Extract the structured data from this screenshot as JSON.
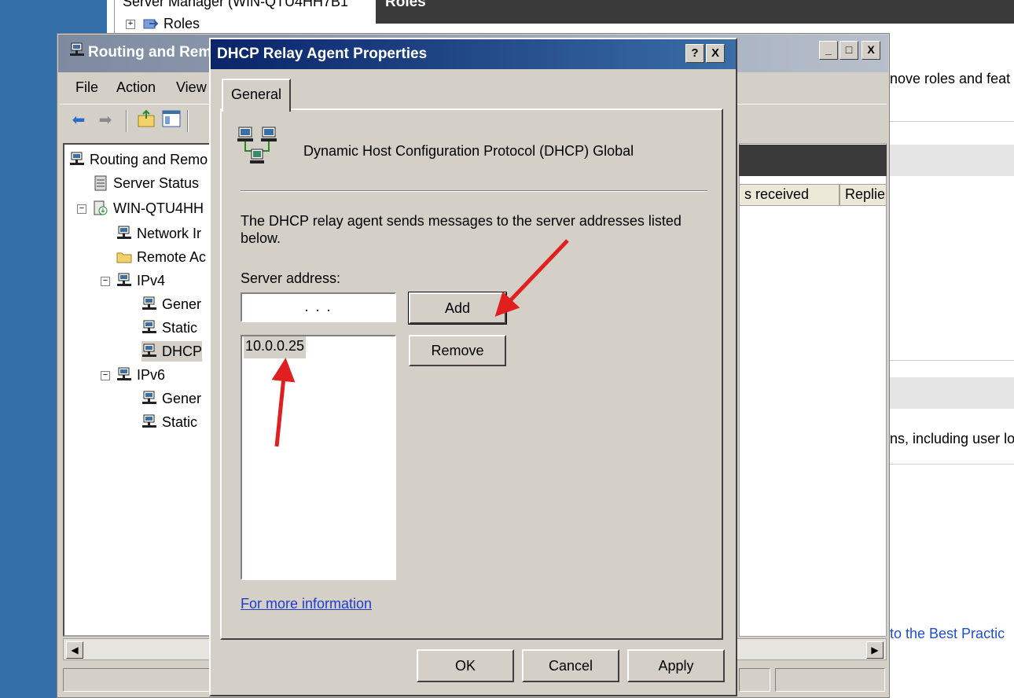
{
  "server_manager": {
    "tree_title": "Server Manager (WIN-QTU4HH7B1",
    "roles_node": "Roles",
    "roles_header": "Roles",
    "right_text_1": "nove roles and feat",
    "right_text_2": "ns, including user lo",
    "right_link": "to the Best Practic"
  },
  "rra_window": {
    "title": "Routing and Rem",
    "controls": {
      "minimize": "_",
      "maximize": "□",
      "close": "X"
    },
    "menu": [
      "File",
      "Action",
      "View"
    ],
    "tree": [
      {
        "label": "Routing and Remo",
        "icon": "server-computer-icon"
      },
      {
        "label": "Server Status",
        "icon": "server-status-icon"
      },
      {
        "label": "WIN-QTU4HH",
        "icon": "server-node-icon"
      },
      {
        "label": "Network Ir",
        "icon": "network-icon"
      },
      {
        "label": "Remote Ac",
        "icon": "folder-icon"
      },
      {
        "label": "IPv4",
        "icon": "network-icon"
      },
      {
        "label": "Gener",
        "icon": "network-icon"
      },
      {
        "label": "Static",
        "icon": "network-icon"
      },
      {
        "label": "DHCP",
        "icon": "network-icon"
      },
      {
        "label": "IPv6",
        "icon": "network-icon"
      },
      {
        "label": "Gener",
        "icon": "network-icon"
      },
      {
        "label": "Static",
        "icon": "network-icon"
      }
    ],
    "columns": [
      "s received",
      "Replie"
    ]
  },
  "dialog": {
    "title": "DHCP Relay Agent Properties",
    "help_btn": "?",
    "close_btn": "X",
    "tab": "General",
    "header": "Dynamic Host Configuration Protocol (DHCP) Global",
    "description": "The DHCP relay agent sends messages to the server addresses listed below.",
    "server_address_label": "Server address:",
    "ip_placeholder": ".      .      .",
    "add_button": "Add",
    "remove_button": "Remove",
    "servers": [
      "10.0.0.25"
    ],
    "more_info_link": "For more information",
    "ok": "OK",
    "cancel": "Cancel",
    "apply": "Apply"
  },
  "colors": {
    "dialog_title": "#0a246a",
    "annotation_arrow": "#e02020",
    "link": "#1e3ccf"
  }
}
